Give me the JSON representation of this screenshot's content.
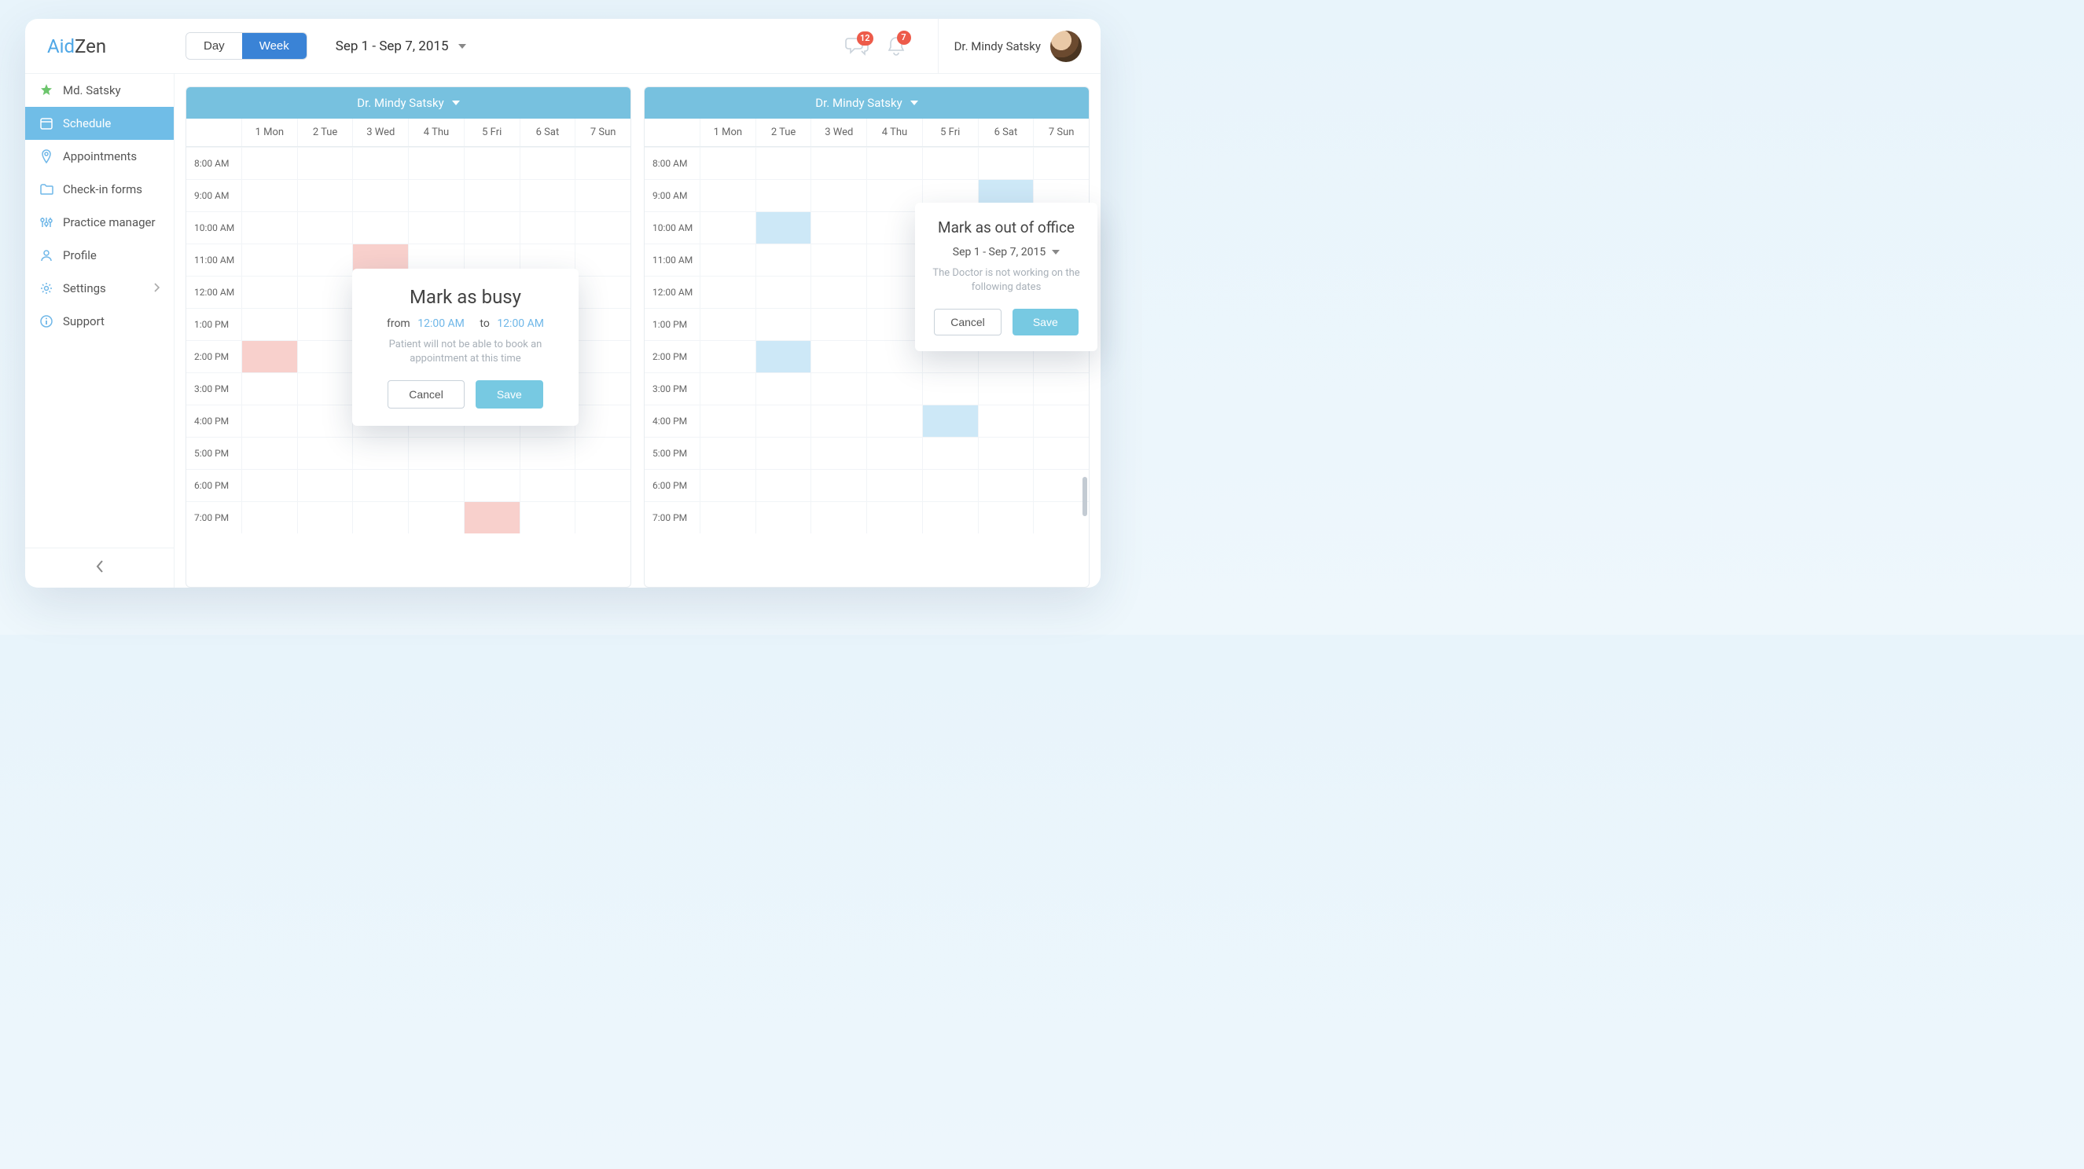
{
  "brand": {
    "first": "Aid",
    "second": "Zen"
  },
  "topbar": {
    "view": {
      "day": "Day",
      "week": "Week"
    },
    "date_range": "Sep 1 - Sep 7, 2015",
    "badges": {
      "messages": "12",
      "alerts": "7"
    },
    "user_name": "Dr. Mindy Satsky"
  },
  "sidebar": {
    "items": [
      {
        "label": "Md. Satsky"
      },
      {
        "label": "Schedule"
      },
      {
        "label": "Appointments"
      },
      {
        "label": "Check-in forms"
      },
      {
        "label": "Practice manager"
      },
      {
        "label": "Profile"
      },
      {
        "label": "Settings"
      },
      {
        "label": "Support"
      }
    ]
  },
  "calendar": {
    "doctor": "Dr. Mindy Satsky",
    "days": [
      "1 Mon",
      "2 Tue",
      "3 Wed",
      "4 Thu",
      "5 Fri",
      "6 Sat",
      "7 Sun"
    ],
    "times": [
      "8:00 AM",
      "9:00 AM",
      "10:00 AM",
      "11:00 AM",
      "12:00 AM",
      "1:00 PM",
      "2:00 PM",
      "3:00 PM",
      "4:00 PM",
      "5:00 PM",
      "6:00 PM",
      "7:00 PM"
    ],
    "left_blocks_pink": [
      {
        "day": 3,
        "row": 3,
        "marker": true
      },
      {
        "day": 1,
        "row": 6
      },
      {
        "day": 5,
        "row": 11
      }
    ],
    "right_blocks_blue": [
      {
        "day": 6,
        "row": 1,
        "marker": true
      },
      {
        "day": 2,
        "row": 2
      },
      {
        "day": 5,
        "row": 4
      },
      {
        "day": 2,
        "row": 6
      },
      {
        "day": 5,
        "row": 8
      }
    ]
  },
  "popovers": {
    "busy": {
      "title": "Mark as busy",
      "from_label": "from",
      "from_time": "12:00 AM",
      "to_label": "to",
      "to_time": "12:00 AM",
      "sub": "Patient will not be able to book an appointment at this time",
      "cancel": "Cancel",
      "save": "Save"
    },
    "ooo": {
      "title": "Mark as out of office",
      "range": "Sep 1 - Sep 7, 2015",
      "sub": "The Doctor is not working on the following dates",
      "cancel": "Cancel",
      "save": "Save"
    }
  }
}
